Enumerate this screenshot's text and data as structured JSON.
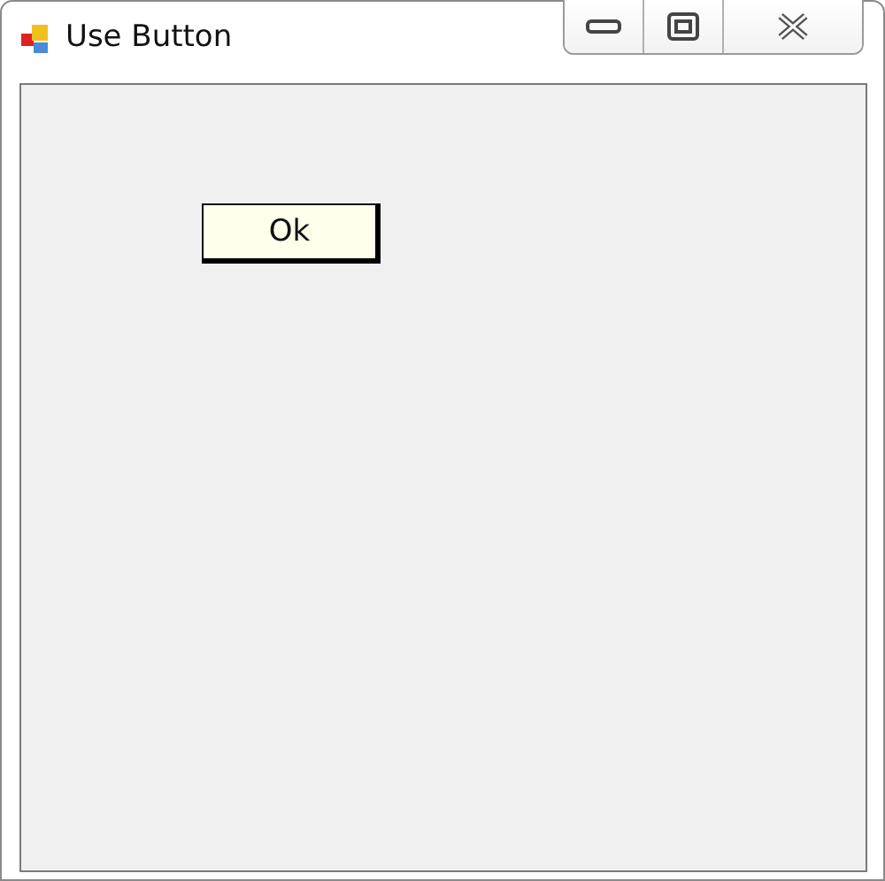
{
  "window": {
    "title": "Use Button"
  },
  "button": {
    "label": "Ok"
  }
}
